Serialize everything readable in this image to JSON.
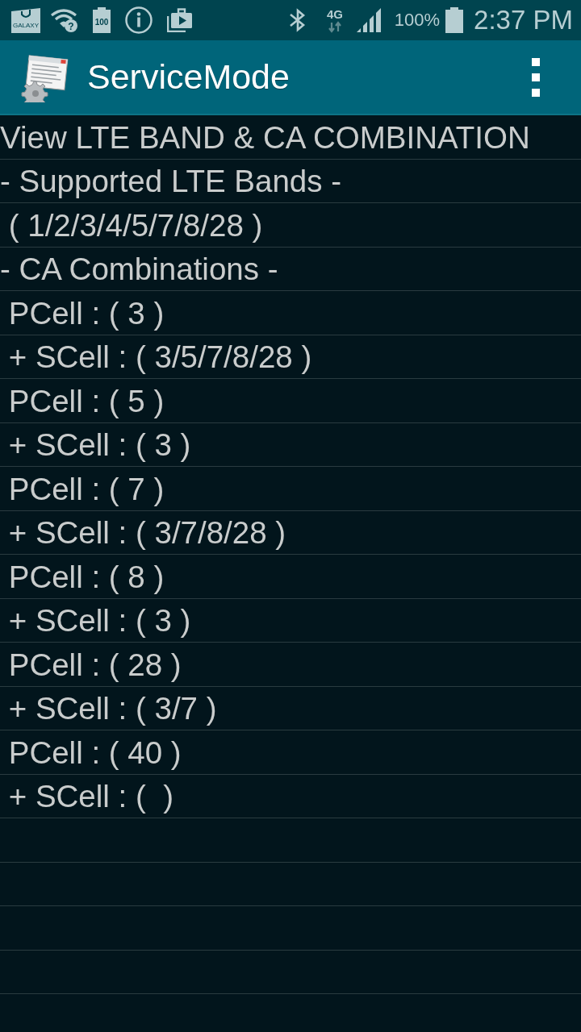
{
  "status_bar": {
    "notification_icons": [
      {
        "kind": "store",
        "label": "GALAXY"
      },
      {
        "kind": "wifi",
        "label": "?"
      },
      {
        "kind": "battery-badge",
        "label": "100"
      },
      {
        "kind": "info"
      },
      {
        "kind": "media"
      }
    ],
    "system_icons": [
      {
        "kind": "bluetooth"
      },
      {
        "kind": "network",
        "label": "4G"
      },
      {
        "kind": "signal"
      }
    ],
    "battery_text": "100%",
    "time": "2:37 PM"
  },
  "app_bar": {
    "title": "ServiceMode"
  },
  "list": {
    "rows": [
      "View LTE BAND & CA COMBINATION",
      "- Supported LTE Bands -",
      " ( 1/2/3/4/5/7/8/28 )",
      "- CA Combinations -",
      " PCell : ( 3 )",
      " + SCell : ( 3/5/7/8/28 )",
      " PCell : ( 5 )",
      " + SCell : ( 3 )",
      " PCell : ( 7 )",
      " + SCell : ( 3/7/8/28 )",
      " PCell : ( 8 )",
      " + SCell : ( 3 )",
      " PCell : ( 28 )",
      " + SCell : ( 3/7 )",
      " PCell : ( 40 )",
      " + SCell : (  )"
    ]
  }
}
